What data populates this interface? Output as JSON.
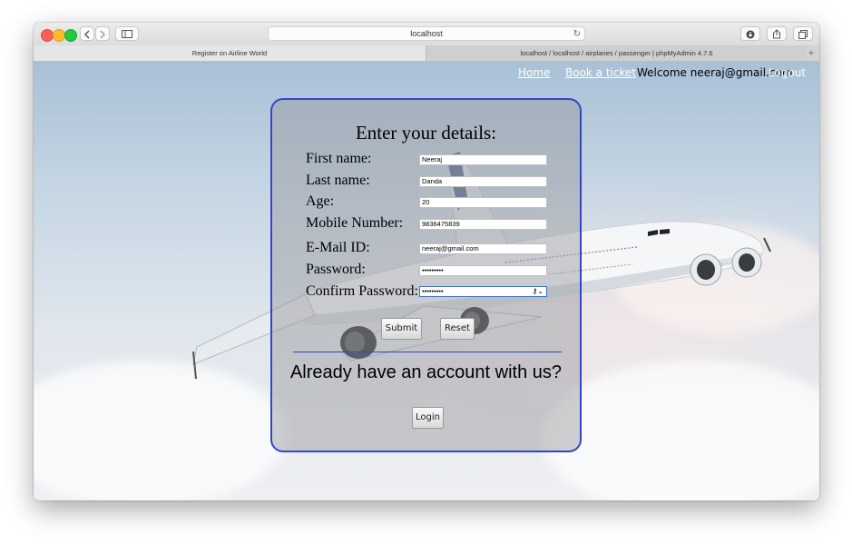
{
  "browser": {
    "url": "localhost",
    "tabs": [
      {
        "label": "Register on Airline World"
      },
      {
        "label": "localhost / localhost / airplanes / passenger | phpMyAdmin 4.7.6"
      }
    ]
  },
  "nav": {
    "home": "Home",
    "book": "Book a ticket",
    "welcome": "Welcome neeraj@gmail.com",
    "logout": "Logout"
  },
  "form": {
    "title": "Enter your details:",
    "fields": [
      {
        "label": "First name:",
        "value": "Neeraj"
      },
      {
        "label": "Last name:",
        "value": "Danda"
      },
      {
        "label": "Age:",
        "value": "20"
      },
      {
        "label": "Mobile Number:",
        "value": "9836475839"
      },
      {
        "label": "E-Mail ID:",
        "value": "neeraj@gmail.com"
      },
      {
        "label": "Password:",
        "value": "•••••••••"
      },
      {
        "label": "Confirm Password:",
        "value": "•••••••••"
      }
    ],
    "submit": "Submit",
    "reset": "Reset",
    "already": "Already have an account with us?",
    "login": "Login"
  },
  "colors": {
    "form_border": "#3545c6",
    "nav_link": "#ffffff"
  }
}
